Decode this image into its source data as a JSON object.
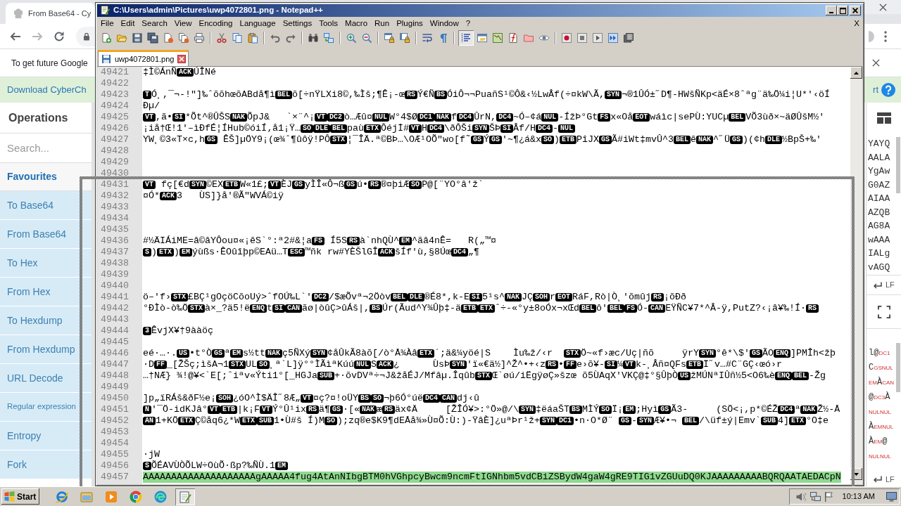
{
  "browser": {
    "tabs": [
      {
        "title": "From Base64 - Cy",
        "selected": true
      }
    ],
    "info_bar": {
      "text": "To get future Google"
    },
    "cyberchef": {
      "banner": {
        "download_link": "Download CyberCh",
        "support_link": "rt"
      },
      "operations": {
        "title": "Operations",
        "search": {
          "placeholder": "Search..."
        },
        "category": {
          "label": "Favourites"
        },
        "items": [
          "To Base64",
          "From Base64",
          "To Hex",
          "From Hex",
          "To Hexdump",
          "From Hexdump",
          "URL Decode",
          "Regular expression",
          "Entropy",
          "Fork"
        ]
      },
      "input": {
        "lines": [
          "YAYQ",
          "AALA",
          "YgAw",
          "G0AZ",
          "AIAA",
          "AZQB",
          "AG8A",
          "wAAA",
          "IALg",
          "vAGQ"
        ],
        "eol": "LF"
      },
      "output": {
        "lines": [
          {
            "segments": [
              {
                "kind": "text",
                "text": "l@"
              },
              {
                "kind": "ctrl",
                "text": "DC1"
              }
            ]
          },
          {
            "segments": [
              {
                "kind": "text",
                "text": "C"
              },
              {
                "kind": "ctrl",
                "text": "GS"
              },
              {
                "kind": "ctrl",
                "text": "NUL"
              }
            ]
          },
          {
            "segments": [
              {
                "kind": "ctrl",
                "text": "EM"
              },
              {
                "kind": "text",
                "text": "À"
              },
              {
                "kind": "ctrl",
                "text": "CAN"
              }
            ]
          },
          {
            "segments": [
              {
                "kind": "text",
                "text": "@"
              },
              {
                "kind": "ctrl",
                "text": "DC3"
              },
              {
                "kind": "text",
                "text": "À"
              }
            ]
          },
          {
            "segments": [
              {
                "kind": "ctrl",
                "text": "NUL"
              },
              {
                "kind": "ctrl",
                "text": "NUL"
              }
            ]
          },
          {
            "segments": [
              {
                "kind": "text",
                "text": "À"
              },
              {
                "kind": "ctrl",
                "text": "EM"
              },
              {
                "kind": "ctrl",
                "text": "NUL"
              }
            ]
          },
          {
            "segments": [
              {
                "kind": "text",
                "text": "À"
              },
              {
                "kind": "ctrl",
                "text": "EM"
              },
              {
                "kind": "text",
                "text": "@"
              }
            ]
          },
          {
            "segments": [
              {
                "kind": "ctrl",
                "text": "NUL"
              },
              {
                "kind": "ctrl",
                "text": "NUL"
              }
            ]
          }
        ],
        "eol": "LF"
      }
    }
  },
  "notepad": {
    "title": "C:\\Users\\admin\\Pictures\\uwp4072801.png - Notepad++",
    "menu": [
      "File",
      "Edit",
      "Search",
      "View",
      "Encoding",
      "Language",
      "Settings",
      "Tools",
      "Macro",
      "Run",
      "Plugins",
      "Window",
      "?"
    ],
    "menu_close": "X",
    "toolbar": {
      "indent_guide": {
        "on": true
      }
    },
    "tabs": [
      {
        "label": "uwp4072801.png",
        "selected": true
      }
    ],
    "lines": [
      {
        "number": "49421",
        "highlighted": false,
        "segments": [
          {
            "kind": "text",
            "text": "‡Ì©ÁnÑ"
          },
          {
            "kind": "ctrl",
            "text": "ACK"
          },
          {
            "kind": "text",
            "text": "ÚÎNé"
          }
        ]
      },
      {
        "number": "49422"
      },
      {
        "number": "49423",
        "highlighted": false,
        "segments": [
          {
            "kind": "ctrl",
            "text": "T"
          },
          {
            "kind": "text",
            "text": "Ó¸,¯¬-!\"]‰ˆõõhœõABdå¶ì"
          },
          {
            "kind": "ctrl",
            "text": "BEL"
          },
          {
            "kind": "text",
            "text": "õ[÷nŸLXi8©,‰Ìš;¶Ê¡-œ"
          },
          {
            "kind": "ctrl",
            "text": "RS"
          },
          {
            "kind": "text",
            "text": "Ý€Ñ"
          },
          {
            "kind": "ctrl",
            "text": "BS"
          },
          {
            "kind": "text",
            "text": "ÓiÔ¬¬PuañS¹©Ô&‹½LwÂf(÷¤kW\\Ã,"
          },
          {
            "kind": "ctrl",
            "text": "SYN"
          },
          {
            "kind": "text",
            "text": "¬®1ÛÓ±˝D¶-HWšÑKp<äÉ×8ˆªg¨ä‰Ö¼i¦U*'‹öÍ"
          }
        ]
      },
      {
        "number": "49424",
        "highlighted": false,
        "segments": [
          {
            "kind": "text",
            "text": "Ðµ/"
          }
        ]
      },
      {
        "number": "49425",
        "highlighted": false,
        "segments": [
          {
            "kind": "ctrl",
            "text": "VT"
          },
          {
            "kind": "text",
            "text": ",ã•"
          },
          {
            "kind": "ctrl",
            "text": "SI"
          },
          {
            "kind": "text",
            "text": "*Õt^®ÛŠS"
          },
          {
            "kind": "ctrl",
            "text": "NAK"
          },
          {
            "kind": "text",
            "text": "ÕpJ&   `×¨^¡"
          },
          {
            "kind": "ctrl",
            "text": "VT"
          },
          {
            "kind": "ctrl",
            "text": "DC2"
          },
          {
            "kind": "text",
            "text": "ò…Æû¤"
          },
          {
            "kind": "ctrl",
            "text": "NUL"
          },
          {
            "kind": "text",
            "text": "W°4$Ø"
          },
          {
            "kind": "ctrl",
            "text": "DC1"
          },
          {
            "kind": "ctrl",
            "text": "NAK"
          },
          {
            "kind": "text",
            "text": "f"
          },
          {
            "kind": "ctrl",
            "text": "DC4"
          },
          {
            "kind": "text",
            "text": "ÛrN,"
          },
          {
            "kind": "ctrl",
            "text": "DC4"
          },
          {
            "kind": "text",
            "text": "~Ó–¢á"
          },
          {
            "kind": "ctrl",
            "text": "NUL"
          },
          {
            "kind": "text",
            "text": "-ÍžÞ°Gt"
          },
          {
            "kind": "ctrl",
            "text": "FS"
          },
          {
            "kind": "text",
            "text": "x«Oå"
          },
          {
            "kind": "ctrl",
            "text": "EOT"
          },
          {
            "kind": "text",
            "text": "wáìc|sePÙ:YUCµ"
          },
          {
            "kind": "ctrl",
            "text": "BEL"
          },
          {
            "kind": "text",
            "text": "VÕ3ùð×~äØÛšM½'"
          }
        ]
      },
      {
        "number": "49426",
        "highlighted": false,
        "segments": [
          {
            "kind": "text",
            "text": "¡iå†Œ!1'–ìÐfÉ¦ÍHub©óiÍ‚å1¡Ÿ…"
          },
          {
            "kind": "ctrl",
            "text": "SO"
          },
          {
            "kind": "ctrl",
            "text": "DLE"
          },
          {
            "kind": "ctrl",
            "text": "BEL"
          },
          {
            "kind": "text",
            "text": "paù"
          },
          {
            "kind": "ctrl",
            "text": "ETX"
          },
          {
            "kind": "text",
            "text": "Ôéjİ#"
          },
          {
            "kind": "ctrl",
            "text": "VT"
          },
          {
            "kind": "text",
            "text": "H"
          },
          {
            "kind": "ctrl",
            "text": "DC4"
          },
          {
            "kind": "text",
            "text": "\\ðÔŠi"
          },
          {
            "kind": "ctrl",
            "text": "SYN"
          },
          {
            "kind": "text",
            "text": "ŠÞ"
          },
          {
            "kind": "ctrl",
            "text": "SI"
          },
          {
            "kind": "text",
            "text": "Âf/H"
          },
          {
            "kind": "ctrl",
            "text": "DC4"
          },
          {
            "kind": "text",
            "text": "-"
          },
          {
            "kind": "ctrl",
            "text": "NUL"
          }
        ]
      },
      {
        "number": "49427",
        "highlighted": false,
        "segments": [
          {
            "kind": "text",
            "text": "YW¸©3«T×c,h"
          },
          {
            "kind": "ctrl",
            "text": "GS"
          },
          {
            "kind": "text",
            "text": " ÊŠ]µÖY9¡(œ¾ˆ¶ûôÿ!PÔ"
          },
          {
            "kind": "ctrl",
            "text": "STX"
          },
          {
            "kind": "text",
            "text": "¦¯ÎÄ.ª©BÞ…\\OÆ¹OÕ\"wo[f˜"
          },
          {
            "kind": "ctrl",
            "text": "GS"
          },
          {
            "kind": "text",
            "text": "Ý"
          },
          {
            "kind": "ctrl",
            "text": "GS"
          },
          {
            "kind": "text",
            "text": "'~¶¿á&x"
          },
          {
            "kind": "ctrl",
            "text": "SO"
          },
          {
            "kind": "text",
            "text": ")"
          },
          {
            "kind": "ctrl",
            "text": "ETB"
          },
          {
            "kind": "text",
            "text": "PîJX"
          },
          {
            "kind": "ctrl",
            "text": "GS"
          },
          {
            "kind": "text",
            "text": "Ã#iWt‡mvÛ^3"
          },
          {
            "kind": "ctrl",
            "text": "BEL"
          },
          {
            "kind": "text",
            "text": "ê"
          },
          {
            "kind": "ctrl",
            "text": "NAK"
          },
          {
            "kind": "text",
            "text": "^˝Ü"
          },
          {
            "kind": "ctrl",
            "text": "GS"
          },
          {
            "kind": "text",
            "text": ")(¢h"
          },
          {
            "kind": "ctrl",
            "text": "DLE"
          },
          {
            "kind": "text",
            "text": "½BpŠ+‰'"
          }
        ]
      },
      {
        "number": "49428"
      },
      {
        "number": "49429"
      },
      {
        "number": "49430"
      },
      {
        "number": "49431",
        "highlighted": false,
        "segments": [
          {
            "kind": "ctrl",
            "text": "VT"
          },
          {
            "kind": "text",
            "text": " fç[€d"
          },
          {
            "kind": "ctrl",
            "text": "SYN"
          },
          {
            "kind": "text",
            "text": "©EX"
          },
          {
            "kind": "ctrl",
            "text": "ETB"
          },
          {
            "kind": "text",
            "text": "W«1£;"
          },
          {
            "kind": "ctrl",
            "text": "VT"
          },
          {
            "kind": "text",
            "text": "ÈJ"
          },
          {
            "kind": "ctrl",
            "text": "GS"
          },
          {
            "kind": "text",
            "text": "yÌÎ«Ô¬ß"
          },
          {
            "kind": "ctrl",
            "text": "GS"
          },
          {
            "kind": "text",
            "text": "ú•"
          },
          {
            "kind": "ctrl",
            "text": "RS"
          },
          {
            "kind": "text",
            "text": "®¤þiÆ"
          },
          {
            "kind": "ctrl",
            "text": "SO"
          },
          {
            "kind": "text",
            "text": "P@[¨YO°â'ž`"
          }
        ]
      },
      {
        "number": "49432",
        "highlighted": false,
        "segments": [
          {
            "kind": "text",
            "text": "¤Ó*"
          },
          {
            "kind": "ctrl",
            "text": "ACK"
          },
          {
            "kind": "text",
            "text": "3   ÙS]}å'®Ã\"WVÁ©iÿ"
          }
        ]
      },
      {
        "number": "49433"
      },
      {
        "number": "49434"
      },
      {
        "number": "49435"
      },
      {
        "number": "49436",
        "highlighted": false,
        "segments": [
          {
            "kind": "text",
            "text": "#½ÄIÁiME=â©âYÔou¤«¡êS`°:ª2#&¦a"
          },
          {
            "kind": "ctrl",
            "text": "FS"
          },
          {
            "kind": "text",
            "text": " Í5S"
          },
          {
            "kind": "ctrl",
            "text": "RS"
          },
          {
            "kind": "text",
            "text": "à`nhQÙ^"
          },
          {
            "kind": "ctrl",
            "text": "EM"
          },
          {
            "kind": "text",
            "text": "^ãâ4nÊ=   R(„™¤"
          }
        ]
      },
      {
        "number": "49437",
        "highlighted": false,
        "segments": [
          {
            "kind": "ctrl",
            "text": "S"
          },
          {
            "kind": "text",
            "text": ")"
          },
          {
            "kind": "ctrl",
            "text": "ETX"
          },
          {
            "kind": "text",
            "text": ")"
          },
          {
            "kind": "ctrl",
            "text": "EM"
          },
          {
            "kind": "text",
            "text": "ýùßs·ÊOûîþp©EAü…T"
          },
          {
            "kind": "ctrl",
            "text": "ESC"
          },
          {
            "kind": "text",
            "text": "™ñk rw#YÈŠlGÎ"
          },
          {
            "kind": "ctrl",
            "text": "ACK"
          },
          {
            "kind": "text",
            "text": "šÍf'ù,§8Úœ"
          },
          {
            "kind": "ctrl",
            "text": "DC4"
          },
          {
            "kind": "text",
            "text": "„¶"
          }
        ]
      },
      {
        "number": "49438"
      },
      {
        "number": "49439"
      },
      {
        "number": "49440"
      },
      {
        "number": "49441",
        "highlighted": false,
        "segments": [
          {
            "kind": "text",
            "text": "ö–'f›"
          },
          {
            "kind": "ctrl",
            "text": "STX"
          },
          {
            "kind": "text",
            "text": "£BÇ¹gOçöCõoUý>ˆfOÚ‰L`'"
          },
          {
            "kind": "ctrl",
            "text": "DC2"
          },
          {
            "kind": "text",
            "text": "/$æÕvª¬2Öòv"
          },
          {
            "kind": "ctrl",
            "text": "BEL"
          },
          {
            "kind": "ctrl",
            "text": "DLE"
          },
          {
            "kind": "text",
            "text": "®É8*,k-E"
          },
          {
            "kind": "ctrl",
            "text": "SI"
          },
          {
            "kind": "text",
            "text": "5¹s^"
          },
          {
            "kind": "ctrl",
            "text": "NAK"
          },
          {
            "kind": "text",
            "text": "JÇ"
          },
          {
            "kind": "ctrl",
            "text": "SOH"
          },
          {
            "kind": "text",
            "text": "r"
          },
          {
            "kind": "ctrl",
            "text": "EOT"
          },
          {
            "kind": "text",
            "text": "RáF,Rò|Ò¸'õmûj"
          },
          {
            "kind": "ctrl",
            "text": "RS"
          },
          {
            "kind": "text",
            "text": "¡õÐð"
          }
        ]
      },
      {
        "number": "49442",
        "highlighted": false,
        "segments": [
          {
            "kind": "text",
            "text": "°ÐÌò-ò‰Ö"
          },
          {
            "kind": "ctrl",
            "text": "STX"
          },
          {
            "kind": "text",
            "text": "à×_?ä5!ë"
          },
          {
            "kind": "ctrl",
            "text": "ENQ"
          },
          {
            "kind": "text",
            "text": "t"
          },
          {
            "kind": "ctrl",
            "text": "SI"
          },
          {
            "kind": "ctrl",
            "text": "CAN"
          },
          {
            "kind": "text",
            "text": "ãø|òûÇ>ûÁš|,"
          },
          {
            "kind": "ctrl",
            "text": "BS"
          },
          {
            "kind": "text",
            "text": "Úr(Ãud^Y¾Ûþ‡-ä"
          },
          {
            "kind": "ctrl",
            "text": "ETB"
          },
          {
            "kind": "ctrl",
            "text": "ETX"
          },
          {
            "kind": "text",
            "text": "ˆ÷-«°y±8oÓx¬xŒd"
          },
          {
            "kind": "ctrl",
            "text": "BEL"
          },
          {
            "kind": "text",
            "text": "ô'"
          },
          {
            "kind": "ctrl",
            "text": "BEL"
          },
          {
            "kind": "ctrl",
            "text": "FS"
          },
          {
            "kind": "text",
            "text": "Ó-"
          },
          {
            "kind": "ctrl",
            "text": "CAN"
          },
          {
            "kind": "text",
            "text": "EŸÑC¥7*^Â-ÿ,PutZ?‹¡â¥‰!Í·"
          },
          {
            "kind": "ctrl",
            "text": "RS"
          }
        ]
      },
      {
        "number": "49443"
      },
      {
        "number": "49444",
        "highlighted": false,
        "segments": [
          {
            "kind": "ctrl",
            "text": "3"
          },
          {
            "kind": "text",
            "text": "ÊvjX¥†9ààöç"
          }
        ]
      },
      {
        "number": "49445"
      },
      {
        "number": "49446",
        "highlighted": false,
        "segments": [
          {
            "kind": "text",
            "text": "eé·…·."
          },
          {
            "kind": "ctrl",
            "text": "US"
          },
          {
            "kind": "text",
            "text": "•t°Ò"
          },
          {
            "kind": "ctrl",
            "text": "GS"
          },
          {
            "kind": "text",
            "text": "ª"
          },
          {
            "kind": "ctrl",
            "text": "EM"
          },
          {
            "kind": "text",
            "text": "s½tt"
          },
          {
            "kind": "ctrl",
            "text": "NAK"
          },
          {
            "kind": "text",
            "text": "ç5ÑXý"
          },
          {
            "kind": "ctrl",
            "text": "SYN"
          },
          {
            "kind": "text",
            "text": "¢åÛkÃ8àõ[/ò°Å¾Àâ"
          },
          {
            "kind": "ctrl",
            "text": "ETX"
          },
          {
            "kind": "text",
            "text": "´;ä&¼yöé|S    Ìu‰ž/‹r  "
          },
          {
            "kind": "ctrl",
            "text": "STX"
          },
          {
            "kind": "text",
            "text": "Ö~«f›æc/Uç|ñõ     ÿrY"
          },
          {
            "kind": "ctrl",
            "text": "SYN"
          },
          {
            "kind": "text",
            "text": "°ê*\\$'"
          },
          {
            "kind": "ctrl",
            "text": "GS"
          },
          {
            "kind": "text",
            "text": "ÃO"
          },
          {
            "kind": "ctrl",
            "text": "ENQ"
          },
          {
            "kind": "text",
            "text": "]PMÎh<žþ"
          }
        ]
      },
      {
        "number": "49447",
        "highlighted": false,
        "segments": [
          {
            "kind": "text",
            "text": "·D"
          },
          {
            "kind": "ctrl",
            "text": "FF"
          },
          {
            "kind": "text",
            "text": "_[ŽŠç;ìšA¬1"
          },
          {
            "kind": "ctrl",
            "text": "STX"
          },
          {
            "kind": "text",
            "text": "UL"
          },
          {
            "kind": "ctrl",
            "text": "SO"
          },
          {
            "kind": "text",
            "text": "¸ª`L]ÿ°°ÌÃìªKúú"
          },
          {
            "kind": "ctrl",
            "text": "NUL"
          },
          {
            "kind": "text",
            "text": "S"
          },
          {
            "kind": "ctrl",
            "text": "ACK"
          },
          {
            "kind": "text",
            "text": "¿      ÙsÞ"
          },
          {
            "kind": "ctrl",
            "text": "SYN"
          },
          {
            "kind": "text",
            "text": "'ï«€ä½]^Ž^•+‹z"
          },
          {
            "kind": "ctrl",
            "text": "RS"
          },
          {
            "kind": "text",
            "text": "•"
          },
          {
            "kind": "ctrl",
            "text": "FF"
          },
          {
            "kind": "text",
            "text": "e›õ¥-"
          },
          {
            "kind": "ctrl",
            "text": "SI"
          },
          {
            "kind": "text",
            "text": "¼"
          },
          {
            "kind": "ctrl",
            "text": "VT"
          },
          {
            "kind": "text",
            "text": "k-¸Âñ¤QFs"
          },
          {
            "kind": "ctrl",
            "text": "ETB"
          },
          {
            "kind": "text",
            "text": "Ï˝v…#C¨GÇ‹œó›r"
          }
        ]
      },
      {
        "number": "49448",
        "highlighted": false,
        "segments": [
          {
            "kind": "text",
            "text": "…†NÆ} ¾!@¥<`E[;ˆiªv«Ýti1°[_HGJa"
          },
          {
            "kind": "ctrl",
            "text": "SUB"
          },
          {
            "kind": "text",
            "text": "+·õvDVª÷¬J&žåÉJ/Mfâµ.Îqûb"
          },
          {
            "kind": "ctrl",
            "text": "STX"
          },
          {
            "kind": "text",
            "text": "Œ`øú/iËgÿøÇ»šzœ õ5ÙAqX'VKÇ@‡°§ÛþÒ"
          },
          {
            "kind": "ctrl",
            "text": "US"
          },
          {
            "kind": "text",
            "text": "žMÚNªIÛñ½5<O6‰è"
          },
          {
            "kind": "ctrl",
            "text": "ENQ"
          },
          {
            "kind": "ctrl",
            "text": "BEL"
          },
          {
            "kind": "text",
            "text": "-Žg"
          }
        ]
      },
      {
        "number": "49449"
      },
      {
        "number": "49450",
        "highlighted": false,
        "segments": [
          {
            "kind": "text",
            "text": "]p„ïRÁš&ðF½e¡"
          },
          {
            "kind": "ctrl",
            "text": "SOH"
          },
          {
            "kind": "text",
            "text": "¿óO^Ì$ÄÎ˝8Æ„"
          },
          {
            "kind": "ctrl",
            "text": "VT"
          },
          {
            "kind": "text",
            "text": "¤ç?¤!oÜY"
          },
          {
            "kind": "ctrl",
            "text": "BS"
          },
          {
            "kind": "ctrl",
            "text": "SO"
          },
          {
            "kind": "text",
            "text": "¬þ6Ó°úë"
          },
          {
            "kind": "ctrl",
            "text": "DC4"
          },
          {
            "kind": "ctrl",
            "text": "CAN"
          },
          {
            "kind": "text",
            "text": "dj‹û"
          }
        ]
      },
      {
        "number": "49451",
        "highlighted": false,
        "segments": [
          {
            "kind": "ctrl",
            "text": "N"
          },
          {
            "kind": "text",
            "text": "'¯Ö-idKJâ°"
          },
          {
            "kind": "ctrl",
            "text": "VT"
          },
          {
            "kind": "ctrl",
            "text": "ETB"
          },
          {
            "kind": "text",
            "text": "|k¡F"
          },
          {
            "kind": "ctrl",
            "text": "VT"
          },
          {
            "kind": "text",
            "text": "Ý°Û¹ix"
          },
          {
            "kind": "ctrl",
            "text": "RS"
          },
          {
            "kind": "text",
            "text": "ä¶"
          },
          {
            "kind": "ctrl",
            "text": "GS"
          },
          {
            "kind": "text",
            "text": "·[«"
          },
          {
            "kind": "ctrl",
            "text": "NAK"
          },
          {
            "kind": "text",
            "text": "æ"
          },
          {
            "kind": "ctrl",
            "text": "RS"
          },
          {
            "kind": "text",
            "text": "äx¢Ä     [ŽÎÓ¥>:°Ö»@/\\"
          },
          {
            "kind": "ctrl",
            "text": "SYN"
          },
          {
            "kind": "text",
            "text": "‡ëáaŠT"
          },
          {
            "kind": "ctrl",
            "text": "BS"
          },
          {
            "kind": "text",
            "text": "MÌÝ"
          },
          {
            "kind": "ctrl",
            "text": "SO"
          },
          {
            "kind": "text",
            "text": "Ï¡"
          },
          {
            "kind": "ctrl",
            "text": "EM"
          },
          {
            "kind": "text",
            "text": ";Hyì"
          },
          {
            "kind": "ctrl",
            "text": "GS"
          },
          {
            "kind": "text",
            "text": "Ã3-     (SÖ<¡,p*©ÉŽ"
          },
          {
            "kind": "ctrl",
            "text": "DC4"
          },
          {
            "kind": "text",
            "text": "ª"
          },
          {
            "kind": "ctrl",
            "text": "NAK"
          },
          {
            "kind": "text",
            "text": "Ž½-Å"
          }
        ]
      },
      {
        "number": "49452",
        "highlighted": false,
        "segments": [
          {
            "kind": "ctrl",
            "text": "AN"
          },
          {
            "kind": "text",
            "text": "1+KÖ"
          },
          {
            "kind": "ctrl",
            "text": "ETX"
          },
          {
            "kind": "text",
            "text": "Ç©åq6¿*W"
          },
          {
            "kind": "ctrl",
            "text": "ETX"
          },
          {
            "kind": "ctrl",
            "text": "SUB"
          },
          {
            "kind": "text",
            "text": "1•Ù#š Í)M"
          },
          {
            "kind": "ctrl",
            "text": "SO"
          },
          {
            "kind": "text",
            "text": ");zq®e$K9¶dEÅå¾»Ù¤Õ:Ù:)-ŸâÈ]¿uªÞr¹ž+"
          },
          {
            "kind": "ctrl",
            "text": "SYN"
          },
          {
            "kind": "ctrl",
            "text": "DC1"
          },
          {
            "kind": "text",
            "text": "•n·O*Ø¨ "
          },
          {
            "kind": "ctrl",
            "text": "GS"
          },
          {
            "kind": "text",
            "text": "-"
          },
          {
            "kind": "ctrl",
            "text": "SYN"
          },
          {
            "kind": "text",
            "text": "Æ¥•¬ "
          },
          {
            "kind": "ctrl",
            "text": "BEL"
          },
          {
            "kind": "text",
            "text": "/\\üf±ý|Emv`"
          },
          {
            "kind": "ctrl",
            "text": "SUB"
          },
          {
            "kind": "text",
            "text": "4]"
          },
          {
            "kind": "ctrl",
            "text": "ETX"
          },
          {
            "kind": "text",
            "text": "°O‡e"
          }
        ]
      },
      {
        "number": "49453"
      },
      {
        "number": "49454"
      },
      {
        "number": "49455",
        "highlighted": false,
        "segments": [
          {
            "kind": "text",
            "text": "·jW"
          }
        ]
      },
      {
        "number": "49456",
        "highlighted": false,
        "segments": [
          {
            "kind": "ctrl",
            "text": "S"
          },
          {
            "kind": "text",
            "text": "ÕÉAVÙÒÕLW÷OùÕ·ßp?‰ÑÙ.1"
          },
          {
            "kind": "ctrl",
            "text": "EM"
          }
        ]
      },
      {
        "number": "49457",
        "highlighted": true,
        "segments": [
          {
            "kind": "text",
            "text": "AAAAAAAAAAAAAAAAAAAAgAAAAA4fug4AtAnNIbgBTM0hVGhpcyBwcm9ncmFtIGNhbm5vdCBiZSBydW4gaW4gRE9TIG1vZGUuDQ0KJAAAAAAAAABQRQAATAEDACpN"
          }
        ]
      }
    ]
  },
  "taskbar": {
    "start": "Start",
    "apps": [
      {
        "kind": "ie",
        "selected": false
      },
      {
        "kind": "explorer",
        "selected": false
      },
      {
        "kind": "media",
        "selected": false
      },
      {
        "kind": "chrome",
        "selected": false
      },
      {
        "kind": "edge",
        "selected": false
      },
      {
        "kind": "notepad",
        "selected": true
      }
    ],
    "clock": "10:13 AM"
  }
}
